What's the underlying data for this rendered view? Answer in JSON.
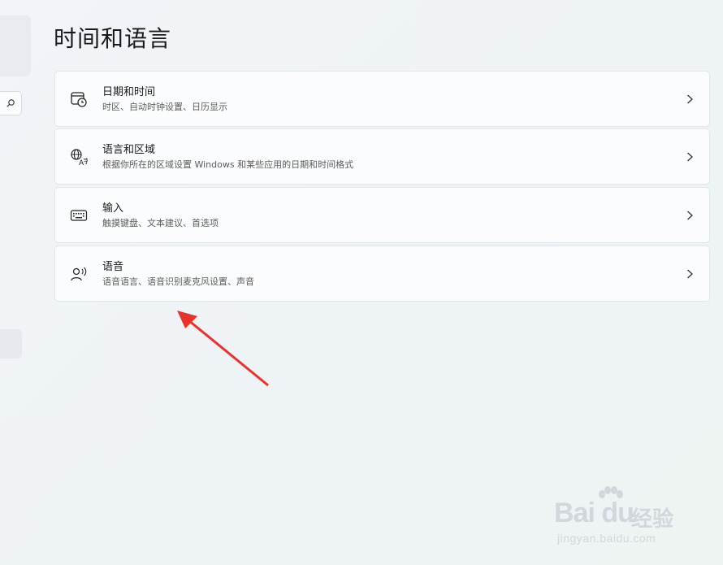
{
  "page": {
    "title": "时间和语言"
  },
  "cards": [
    {
      "title": "日期和时间",
      "subtitle": "时区、自动时钟设置、日历显示",
      "icon": "calendar-clock-icon"
    },
    {
      "title": "语言和区域",
      "subtitle": "根据你所在的区域设置 Windows 和某些应用的日期和时间格式",
      "icon": "language-region-icon"
    },
    {
      "title": "输入",
      "subtitle": "触摸键盘、文本建议、首选项",
      "icon": "keyboard-icon"
    },
    {
      "title": "语音",
      "subtitle": "语音语言、语音识别麦克风设置、声音",
      "icon": "speech-icon"
    }
  ],
  "annotation": {
    "color": "#e8322a"
  },
  "watermark": {
    "logo": "Bai du",
    "brand": "经验",
    "url": "jingyan.baidu.com"
  }
}
